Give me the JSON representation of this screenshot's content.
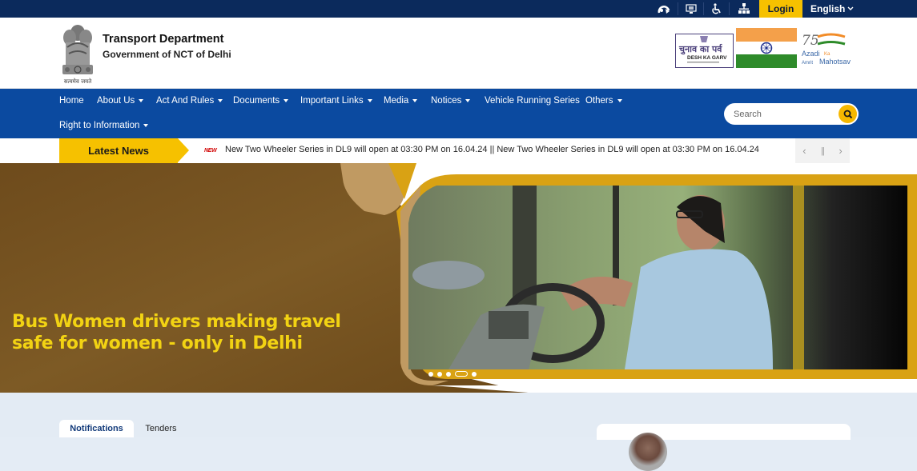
{
  "topbar": {
    "icons": [
      {
        "name": "skip-to-content-icon"
      },
      {
        "name": "screen-reader-icon"
      },
      {
        "name": "accessibility-icon"
      },
      {
        "name": "sitemap-icon"
      }
    ],
    "login_label": "Login",
    "language_label": "English"
  },
  "header": {
    "title": "Transport Department",
    "subtitle": "Government of NCT of Delhi",
    "emblem_motto": "सत्यमेव जयते",
    "logos": {
      "chunav_hindi": "चुनाव का पर्व",
      "chunav_english": "DESH KA GARV",
      "azadi_line1": "Azadi",
      "azadi_ka": "Ka",
      "azadi_line2": "Amrit",
      "azadi_line3": "Mahotsav",
      "azadi_number": "75"
    }
  },
  "nav": {
    "items": [
      {
        "label": "Home",
        "dropdown": false
      },
      {
        "label": "About Us",
        "dropdown": true
      },
      {
        "label": "Act And Rules",
        "dropdown": true
      },
      {
        "label": "Documents",
        "dropdown": true
      },
      {
        "label": "Important Links",
        "dropdown": true
      },
      {
        "label": "Media",
        "dropdown": true
      },
      {
        "label": "Notices",
        "dropdown": true
      },
      {
        "label": "Vehicle Running Series",
        "dropdown": false
      },
      {
        "label": "Others",
        "dropdown": true
      },
      {
        "label": "Right to Information",
        "dropdown": true
      }
    ],
    "search": {
      "placeholder": "Search",
      "value": ""
    }
  },
  "ticker": {
    "label": "Latest News",
    "badge": "NEW",
    "text": "New Two Wheeler Series in DL9 will open at 03:30 PM on 16.04.24 || New Two Wheeler Series in DL9 will open at 03:30 PM on 16.04.24",
    "controls": {
      "prev": "‹",
      "pause": "||",
      "next": "›"
    }
  },
  "hero": {
    "caption_line1": "Bus Women drivers making travel",
    "caption_line2": "safe for women - only in Delhi",
    "slides_total": 5,
    "active_slide": 4
  },
  "bottom": {
    "tabs": [
      {
        "label": "Notifications",
        "active": true
      },
      {
        "label": "Tenders",
        "active": false
      }
    ]
  },
  "colors": {
    "topbar": "#0b2a5c",
    "nav": "#0b4aa0",
    "accent_yellow": "#f6c100",
    "hero_brown": "#7a5522",
    "hero_gold": "#d9a214",
    "page_bg": "#e3ebf4"
  }
}
